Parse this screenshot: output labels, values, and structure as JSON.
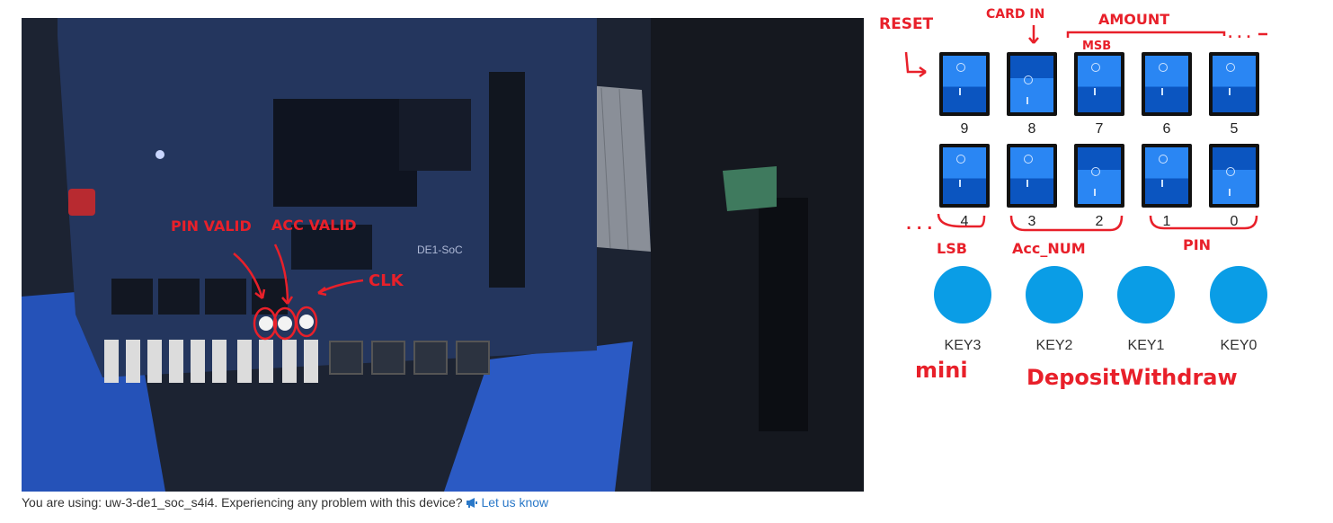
{
  "board": {
    "switches_top": [
      {
        "label": "9",
        "state": "up"
      },
      {
        "label": "8",
        "state": "down"
      },
      {
        "label": "7",
        "state": "up"
      },
      {
        "label": "6",
        "state": "up"
      },
      {
        "label": "5",
        "state": "up"
      }
    ],
    "switches_bottom": [
      {
        "label": "4",
        "state": "up"
      },
      {
        "label": "3",
        "state": "up"
      },
      {
        "label": "2",
        "state": "down"
      },
      {
        "label": "1",
        "state": "up"
      },
      {
        "label": "0",
        "state": "down"
      }
    ],
    "keys": [
      "KEY3",
      "KEY2",
      "KEY1",
      "KEY0"
    ]
  },
  "annotations": {
    "reset": "RESET",
    "card_in": "CARD IN",
    "amount": "AMOUNT",
    "msb": "MSB",
    "lsb": "LSB",
    "acc_num": "Acc_NUM",
    "pin": "PIN",
    "mini": "mini",
    "deposit": "Deposit",
    "withdraw": "Withdraw",
    "pin_valid": "PIN VALID",
    "acc_valid": "ACC VALID",
    "clk": "CLK",
    "dots_right": ". . .",
    "dots_left": ". . ."
  },
  "feed": {
    "board_name": "DE1-SoC"
  },
  "footer": {
    "message": "You are using: uw-3-de1_soc_s4i4. Experiencing any problem with this device?",
    "link": "Let us know"
  },
  "colors": {
    "annotation": "#e8202a",
    "key": "#0a9de6",
    "switch": "#0a60d8",
    "link": "#2a78c8"
  }
}
